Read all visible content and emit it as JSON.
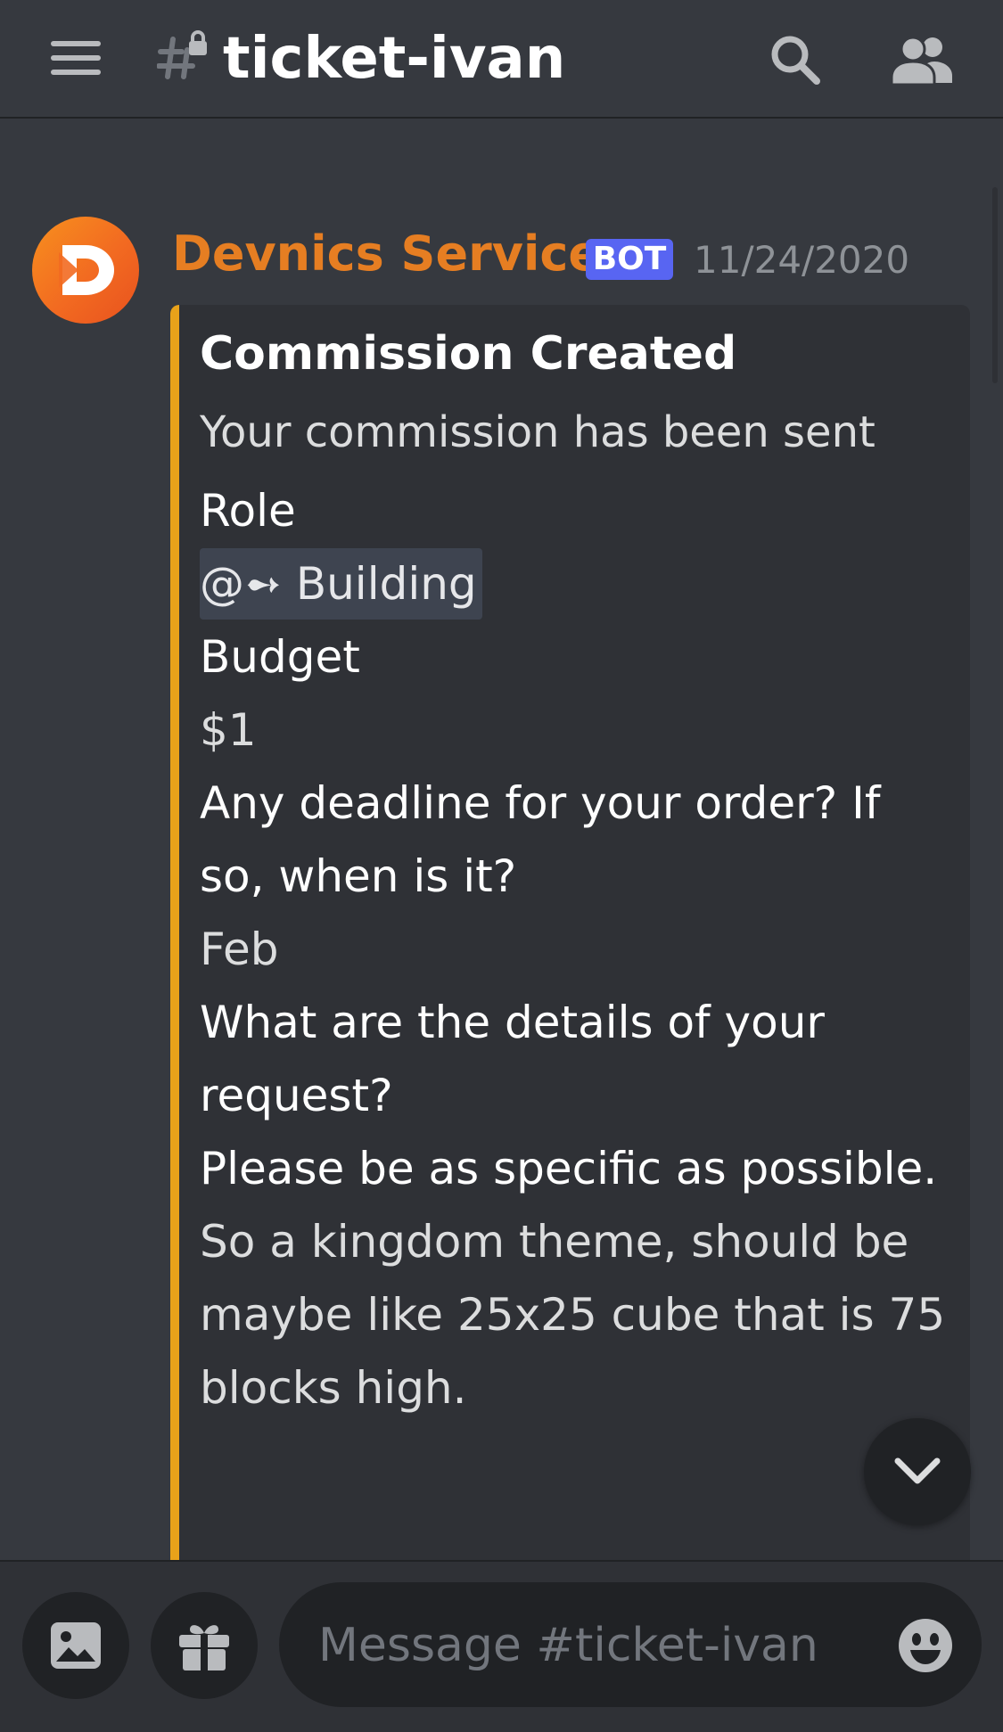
{
  "header": {
    "channel_name": "ticket-ivan",
    "menu_icon": "hamburger-menu-icon",
    "channel_icon": "locked-channel-hash-icon",
    "search_icon": "search-icon",
    "members_icon": "members-icon"
  },
  "message": {
    "author": "Devnics Services",
    "bot_tag": "BOT",
    "timestamp": "11/24/2020",
    "author_color": "#e67e22",
    "embed": {
      "accent_color": "#e8a21a",
      "title": "Commission Created",
      "description": "Your commission has been sent",
      "fields": [
        {
          "name": "Role",
          "mention_prefix": "@➻",
          "value": "Building"
        },
        {
          "name": "Budget",
          "value": "$1"
        },
        {
          "name": "Any deadline for your order? If so, when is it?",
          "value": "Feb"
        },
        {
          "name": "What are the details of your request?\nPlease be as specific as possible.",
          "value": "So a kingdom theme, should be maybe like 25x25 cube that is 75 blocks high."
        }
      ]
    }
  },
  "scroll_to_bottom_icon": "chevron-down-icon",
  "composer": {
    "placeholder": "Message #ticket-ivan",
    "image_icon": "image-upload-icon",
    "gift_icon": "gift-icon",
    "emoji_icon": "emoji-icon"
  },
  "colors": {
    "background": "#36393f",
    "embed_background": "#2f3136",
    "bot_tag": "#5865f2"
  }
}
